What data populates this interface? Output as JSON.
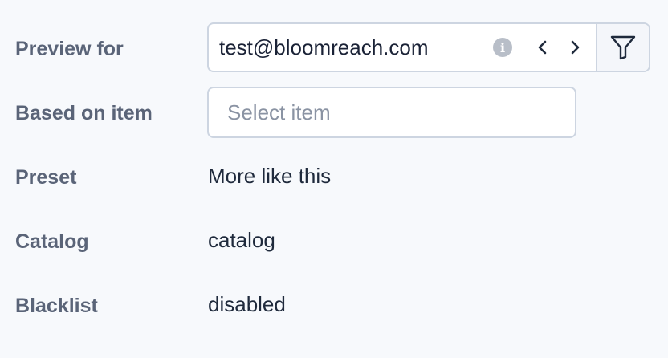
{
  "fields": {
    "preview_for": {
      "label": "Preview for",
      "value": "test@bloomreach.com"
    },
    "based_on_item": {
      "label": "Based on item",
      "placeholder": "Select item"
    },
    "preset": {
      "label": "Preset",
      "value": "More like this"
    },
    "catalog": {
      "label": "Catalog",
      "value": "catalog"
    },
    "blacklist": {
      "label": "Blacklist",
      "value": "disabled"
    }
  },
  "icons": {
    "info": "info-icon",
    "prev": "chevron-left-icon",
    "next": "chevron-right-icon",
    "filter": "filter-icon"
  },
  "colors": {
    "label": "#5a6478",
    "value": "#1f2a3c",
    "border": "#cdd5e1",
    "background": "#f7f9fc"
  }
}
